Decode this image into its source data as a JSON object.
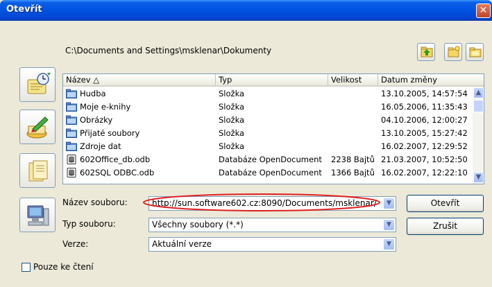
{
  "window": {
    "title": "Otevřít",
    "close_glyph": "✕"
  },
  "path": "C:\\Documents and Settings\\msklenar\\Dokumenty",
  "toolbar": {
    "icons": [
      "up-folder-icon",
      "new-folder-icon",
      "default-folder-icon"
    ]
  },
  "sidebar": {
    "icons": [
      "schedule-icon",
      "edit-document-icon",
      "document-icon",
      "computer-icon"
    ]
  },
  "file_list": {
    "columns": [
      "Název △",
      "Typ",
      "Velikost",
      "Datum změny"
    ],
    "rows": [
      {
        "name": "Hudba",
        "type": "Složka",
        "size": "",
        "date": "13.10.2005, 14:57:54",
        "icon": "folder-icon"
      },
      {
        "name": "Moje e-knihy",
        "type": "Složka",
        "size": "",
        "date": "16.05.2006, 11:35:43",
        "icon": "folder-icon"
      },
      {
        "name": "Obrázky",
        "type": "Složka",
        "size": "",
        "date": "04.10.2006, 12:00:27",
        "icon": "folder-icon"
      },
      {
        "name": "Přijaté soubory",
        "type": "Složka",
        "size": "",
        "date": "13.10.2005, 15:27:42",
        "icon": "folder-icon"
      },
      {
        "name": "Zdroje dat",
        "type": "Složka",
        "size": "",
        "date": "16.02.2007, 12:29:52",
        "icon": "folder-icon"
      },
      {
        "name": "602Office_db.odb",
        "type": "Databáze OpenDocument",
        "size": "2238 Bajtů",
        "date": "21.03.2007, 10:52:50",
        "icon": "database-icon"
      },
      {
        "name": "602SQL ODBC.odb",
        "type": "Databáze OpenDocument",
        "size": "1366 Bajtů",
        "date": "16.02.2007, 12:22:10",
        "icon": "database-icon"
      }
    ]
  },
  "form": {
    "filename_label": "Název souboru:",
    "filename_value": "http://sun.software602.cz:8090/Documents/msklenar/",
    "filetype_label": "Typ souboru:",
    "filetype_value": "Všechny soubory (*.*)",
    "version_label": "Verze:",
    "version_value": "Aktuální verze"
  },
  "buttons": {
    "open": "Otevřít",
    "cancel": "Zrušit"
  },
  "readonly": {
    "label": "Pouze ke čtení",
    "checked": false
  },
  "colors": {
    "title_bar": "#0054e3",
    "highlight": "#e02020",
    "panel": "#ece9d8",
    "border": "#7f9db9"
  }
}
